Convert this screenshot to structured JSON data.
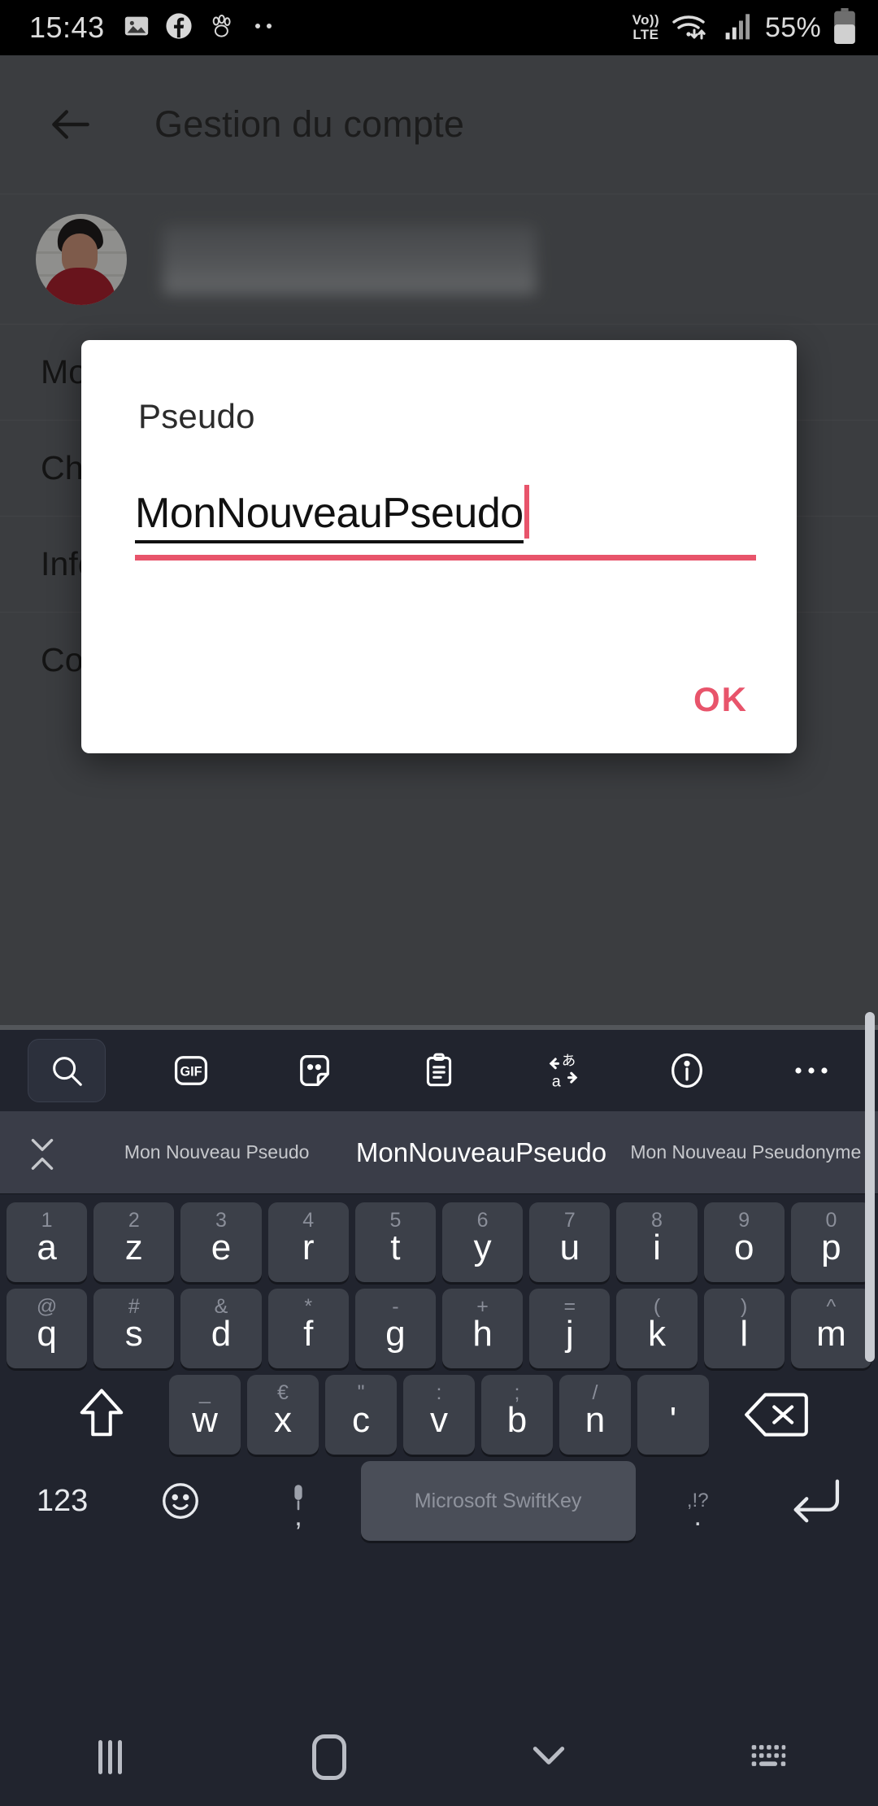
{
  "status_bar": {
    "time": "15:43",
    "left_icons": [
      "photo-icon",
      "facebook-icon",
      "paw-icon",
      "more-notifications-icon"
    ],
    "network_label_top": "Vo))",
    "network_label_bottom": "LTE",
    "right_icons": [
      "wifi-icon",
      "signal-icon",
      "battery-icon"
    ],
    "battery_percent": "55%"
  },
  "app": {
    "title": "Gestion du compte",
    "back_icon": "back-arrow-icon",
    "profile": {
      "avatar": "user-avatar",
      "name_redacted": ""
    },
    "menu_items": [
      {
        "label": "Mo"
      },
      {
        "label": "Ch"
      },
      {
        "label": "Informations personnelles"
      },
      {
        "label": "Comptes associés"
      }
    ]
  },
  "dialog": {
    "title": "Pseudo",
    "input_value": "MonNouveauPseudo",
    "ok_label": "OK",
    "accent_color": "#e8546b"
  },
  "keyboard": {
    "toolbar": [
      {
        "name": "search-icon",
        "active": true
      },
      {
        "name": "gif-icon",
        "label": "GIF"
      },
      {
        "name": "sticker-icon"
      },
      {
        "name": "clipboard-icon"
      },
      {
        "name": "translate-icon"
      },
      {
        "name": "info-icon"
      },
      {
        "name": "more-icon",
        "label": "•••"
      }
    ],
    "suggestions": [
      {
        "text": "Mon Nouveau Pseudo",
        "primary": false
      },
      {
        "text": "MonNouveauPseudo",
        "primary": true
      },
      {
        "text": "Mon Nouveau Pseudonyme",
        "primary": false
      }
    ],
    "expand_icon": "chevron-expand-icon",
    "row1": [
      {
        "main": "a",
        "sup": "1"
      },
      {
        "main": "z",
        "sup": "2"
      },
      {
        "main": "e",
        "sup": "3"
      },
      {
        "main": "r",
        "sup": "4"
      },
      {
        "main": "t",
        "sup": "5"
      },
      {
        "main": "y",
        "sup": "6"
      },
      {
        "main": "u",
        "sup": "7"
      },
      {
        "main": "i",
        "sup": "8"
      },
      {
        "main": "o",
        "sup": "9"
      },
      {
        "main": "p",
        "sup": "0"
      }
    ],
    "row2": [
      {
        "main": "q",
        "sup": "@"
      },
      {
        "main": "s",
        "sup": "#"
      },
      {
        "main": "d",
        "sup": "&"
      },
      {
        "main": "f",
        "sup": "*"
      },
      {
        "main": "g",
        "sup": "-"
      },
      {
        "main": "h",
        "sup": "+"
      },
      {
        "main": "j",
        "sup": "="
      },
      {
        "main": "k",
        "sup": "("
      },
      {
        "main": "l",
        "sup": ")"
      },
      {
        "main": "m",
        "sup": "^"
      }
    ],
    "row3": [
      {
        "main": "w",
        "sup": "_"
      },
      {
        "main": "x",
        "sup": "€"
      },
      {
        "main": "c",
        "sup": "\""
      },
      {
        "main": "v",
        "sup": ":"
      },
      {
        "main": "b",
        "sup": ";"
      },
      {
        "main": "n",
        "sup": "/"
      },
      {
        "main": "'",
        "sup": ""
      }
    ],
    "shift_icon": "shift-icon",
    "backspace_icon": "backspace-icon",
    "bottom": {
      "numeric_label": "123",
      "emoji_icon": "emoji-icon",
      "mic_icon": "microphone-icon",
      "comma": ",",
      "space_label": "Microsoft SwiftKey",
      "punct_sup": ",!?",
      "period": ".",
      "enter_icon": "enter-icon"
    }
  },
  "nav_bar": {
    "recents_icon": "recents-icon",
    "home_icon": "home-icon",
    "hide_keyboard_icon": "hide-keyboard-icon",
    "keyboard_switch_icon": "keyboard-switcher-icon"
  }
}
